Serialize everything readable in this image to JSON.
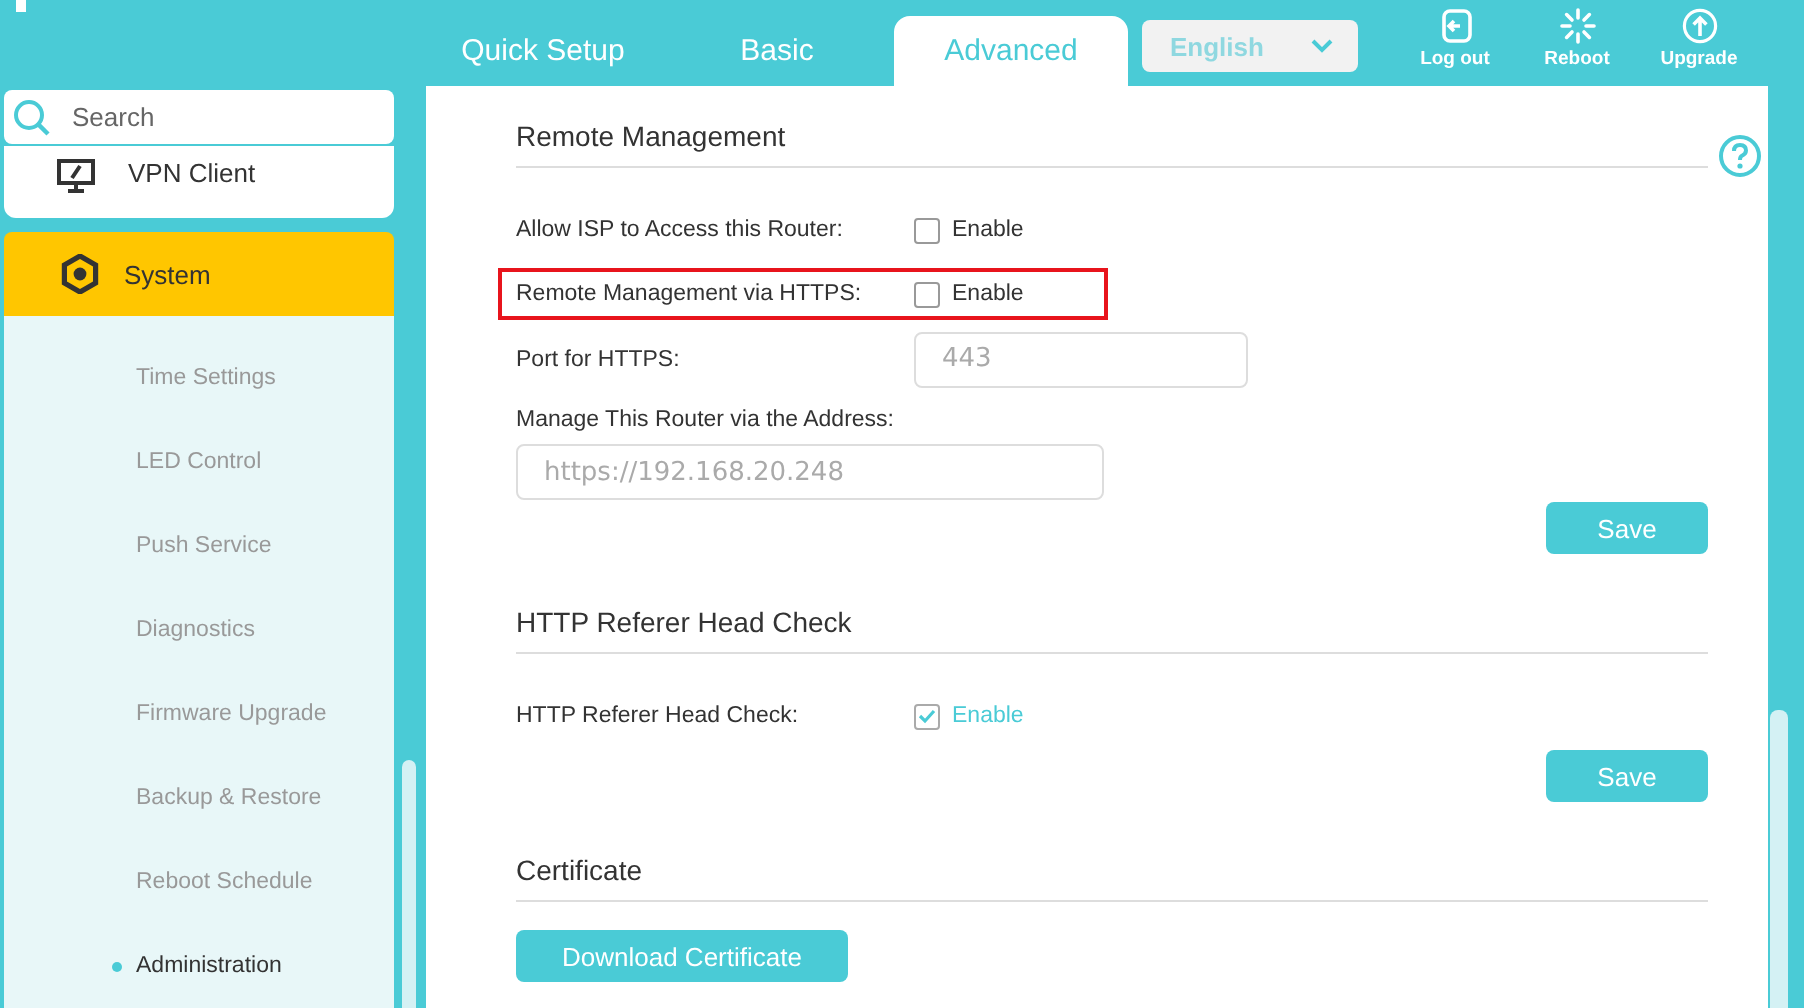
{
  "tabs": [
    {
      "label": "Quick Setup",
      "selected": false
    },
    {
      "label": "Basic",
      "selected": false
    },
    {
      "label": "Advanced",
      "selected": true
    }
  ],
  "language": {
    "value": "English"
  },
  "header_actions": [
    {
      "label": "Log out"
    },
    {
      "label": "Reboot"
    },
    {
      "label": "Upgrade"
    }
  ],
  "sidebar": {
    "search": {
      "placeholder": "Search"
    },
    "items": [
      {
        "label": "VPN Client",
        "selected": false
      },
      {
        "label": "System",
        "selected": true,
        "children": [
          {
            "label": "Time Settings",
            "selected": false
          },
          {
            "label": "LED Control",
            "selected": false
          },
          {
            "label": "Push Service",
            "selected": false
          },
          {
            "label": "Diagnostics",
            "selected": false
          },
          {
            "label": "Firmware Upgrade",
            "selected": false
          },
          {
            "label": "Backup & Restore",
            "selected": false
          },
          {
            "label": "Reboot Schedule",
            "selected": false
          },
          {
            "label": "Administration",
            "selected": true
          }
        ]
      }
    ]
  },
  "sections": [
    {
      "title": "Remote Management",
      "fields": [
        {
          "kind": "checkbox",
          "label": "Allow ISP to Access this Router:",
          "option": "Enable",
          "checked": false,
          "highlighted": false
        },
        {
          "kind": "checkbox",
          "label": "Remote Management via HTTPS:",
          "option": "Enable",
          "checked": false,
          "highlighted": true
        },
        {
          "kind": "input",
          "label": "Port for HTTPS:",
          "value": "443"
        },
        {
          "kind": "input_stacked",
          "label": "Manage This Router via the Address:",
          "value": "https://192.168.20.248"
        },
        {
          "kind": "save_button",
          "label": "Save"
        }
      ]
    },
    {
      "title": "HTTP Referer Head Check",
      "fields": [
        {
          "kind": "checkbox",
          "label": "HTTP Referer Head Check:",
          "option": "Enable",
          "checked": true,
          "highlighted": false
        },
        {
          "kind": "save_button",
          "label": "Save"
        }
      ]
    },
    {
      "title": "Certificate",
      "fields": [
        {
          "kind": "download_button",
          "label": "Download Certificate"
        }
      ]
    }
  ]
}
